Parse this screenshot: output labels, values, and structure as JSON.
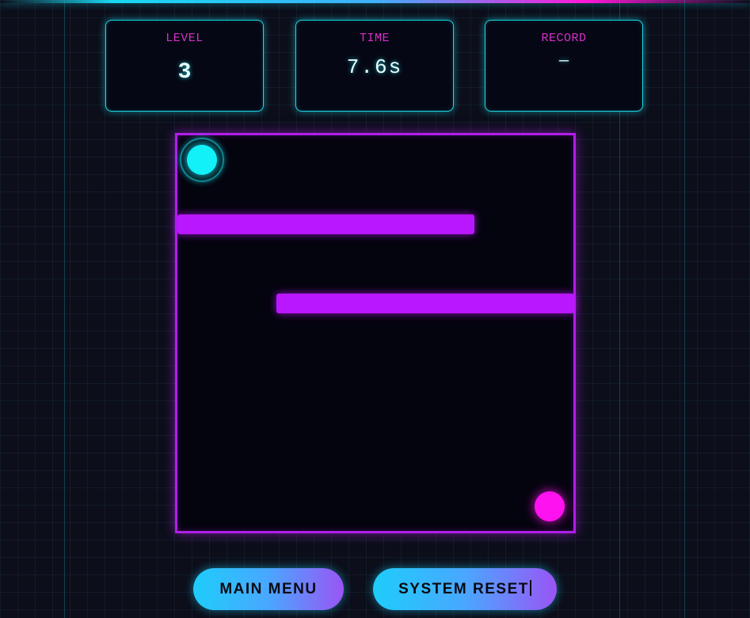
{
  "hud": {
    "level": {
      "label": "LEVEL",
      "value": "3"
    },
    "time": {
      "label": "TIME",
      "value": "7.6s"
    },
    "record": {
      "label": "RECORD",
      "value": "—"
    }
  },
  "buttons": {
    "main_menu": "MAIN MENU",
    "system_reset": "SYSTEM RESET"
  },
  "colors": {
    "background": "#0c0e1a",
    "panel_border": "#1ad9e6",
    "label": "#d62ec8",
    "maze_border": "#b01ee8",
    "wall": "#b817ff",
    "player": "#12f0f8",
    "goal": "#ff12f0"
  }
}
